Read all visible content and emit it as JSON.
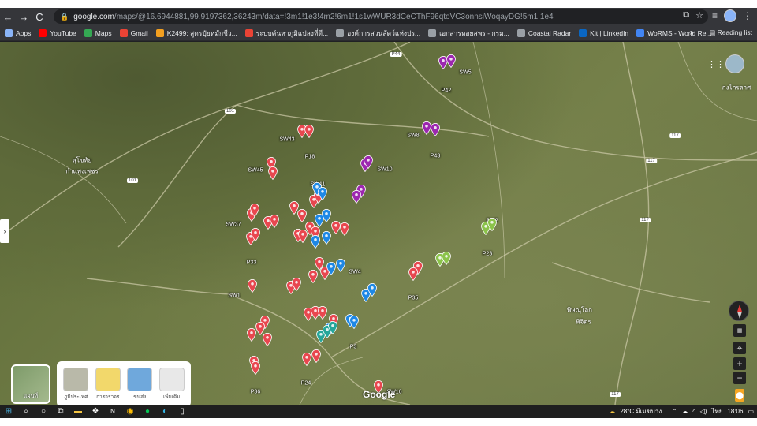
{
  "browser": {
    "url_host": "google.com",
    "url_rest": "/maps/@16.6944881,99.9197362,36243m/data=!3m1!1e3!4m2!6m1!1s1wWUR3dCeCThF96qtoVC3onnsiWoqayDG!5m1!1e4",
    "nav": {
      "back": "←",
      "forward": "→",
      "reload": "C"
    },
    "bookmarks": [
      {
        "label": "Apps",
        "color": "#8ab4f8"
      },
      {
        "label": "YouTube",
        "color": "#ff0000"
      },
      {
        "label": "Maps",
        "color": "#34a853"
      },
      {
        "label": "Gmail",
        "color": "#ea4335"
      },
      {
        "label": "K2499: สูตรปุ๋ยหมักชีว...",
        "color": "#f4a020"
      },
      {
        "label": "ระบบค้นหาภูมิแปลงที่ดี...",
        "color": "#ea4335"
      },
      {
        "label": "องค์การสวนสัตว์แห่งปร...",
        "color": "#9aa0a6"
      },
      {
        "label": "เอกสารหอยสพร - กรม...",
        "color": "#9aa0a6"
      },
      {
        "label": "Coastal Radar",
        "color": "#9aa0a6"
      },
      {
        "label": "Kit | LinkedIn",
        "color": "#0a66c2"
      },
      {
        "label": "WoRMS - World Re...",
        "color": "#4285f4"
      }
    ],
    "more": "»",
    "reading_list": "Reading list"
  },
  "map": {
    "colors": {
      "red": "#e8474f",
      "purple": "#9c27b0",
      "blue": "#1e88e5",
      "green": "#8bc34a",
      "teal": "#26a69a"
    },
    "labels": [
      "SW5",
      "P42",
      "SW8",
      "P43",
      "SW43",
      "P18",
      "SW10",
      "SW45",
      "SW11",
      "SW37",
      "SW2",
      "P23",
      "P33",
      "SW4",
      "P35",
      "SW1",
      "P3",
      "P36",
      "P24",
      "SW16"
    ],
    "road_numbers": [
      "P44",
      "101",
      "101",
      "117",
      "117",
      "117",
      "117"
    ],
    "towns": [
      "สุโขทัย",
      "กำแพงเพชร",
      "พิษณุโลก",
      "พิจิตร",
      "กงไกรลาศ"
    ],
    "google_logo": "Google",
    "attribution": [
      "รูปภาพ ©2021 Maxar Technologies,Maxar Technologies,CNES / Airbus,รูปภาพ ©2021 TerraMetrics,ข้อมูลแผนที่ ©2021",
      "ไทย",
      "ข้อกำหนด",
      "ส่วนบุคคล",
      "ส่งความคิดเห็น",
      "5 กม."
    ],
    "layer_main": "แผนที่",
    "layers": [
      {
        "label": "ภูมิประเทศ",
        "color": "#b9b9a9"
      },
      {
        "label": "การจราจร",
        "color": "#f2d86b"
      },
      {
        "label": "ขนส่ง",
        "color": "#6fa8dc"
      },
      {
        "label": "เพิ่มเติม",
        "color": "#e8e8e8"
      }
    ],
    "controls": {
      "zoom_in": "+",
      "zoom_out": "−",
      "apps": "⋮⋮",
      "locate": "⌖",
      "pegman": "🧍"
    }
  },
  "taskbar": {
    "start": "⊞",
    "weather": "28°C มีเมฆบาง...",
    "lang": "ไทย",
    "time": "18:06"
  }
}
